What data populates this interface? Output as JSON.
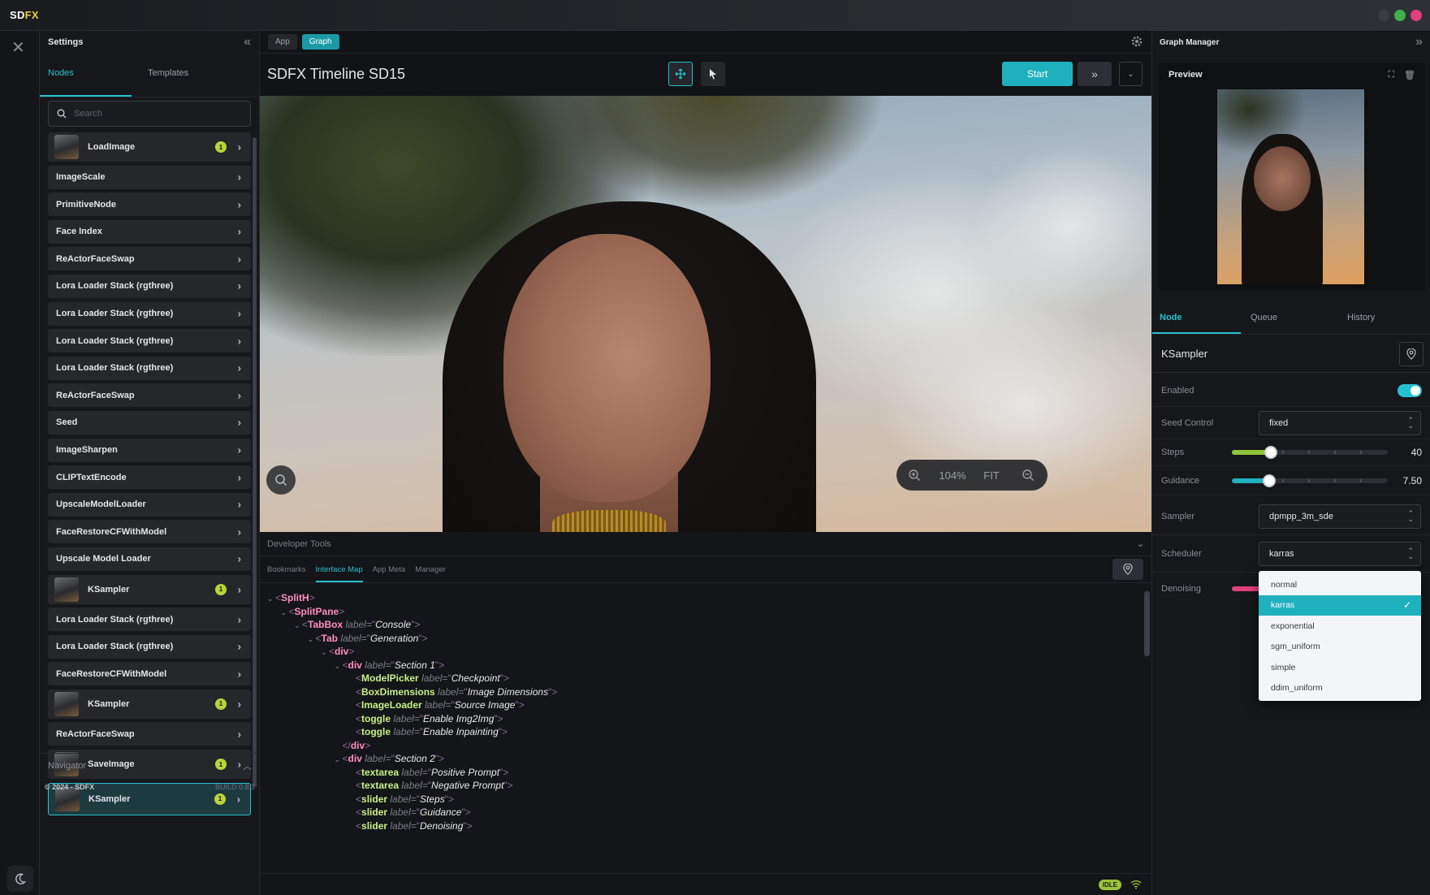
{
  "app": {
    "logo_prefix": "SD",
    "logo_suffix": "FX"
  },
  "colors": {
    "accent": "#25c1cf",
    "start": "#1fb0bd",
    "badge": "#b9d43a",
    "window_dots": [
      "#3b3d42",
      "#3fb04e",
      "#e0407a"
    ]
  },
  "left_panel": {
    "title": "Settings",
    "tabs": [
      "Nodes",
      "Templates"
    ],
    "search_placeholder": "Search",
    "nodes": [
      {
        "label": "LoadImage",
        "badge": "1",
        "thumb": true
      },
      {
        "label": "ImageScale"
      },
      {
        "label": "PrimitiveNode"
      },
      {
        "label": "Face Index"
      },
      {
        "label": "ReActorFaceSwap"
      },
      {
        "label": "Lora Loader Stack (rgthree)"
      },
      {
        "label": "Lora Loader Stack (rgthree)"
      },
      {
        "label": "Lora Loader Stack (rgthree)"
      },
      {
        "label": "Lora Loader Stack (rgthree)"
      },
      {
        "label": "ReActorFaceSwap"
      },
      {
        "label": "Seed"
      },
      {
        "label": "ImageSharpen"
      },
      {
        "label": "CLIPTextEncode"
      },
      {
        "label": "UpscaleModelLoader"
      },
      {
        "label": "FaceRestoreCFWithModel"
      },
      {
        "label": "Upscale Model Loader"
      },
      {
        "label": "KSampler",
        "badge": "1",
        "thumb": true
      },
      {
        "label": "Lora Loader Stack (rgthree)"
      },
      {
        "label": "Lora Loader Stack (rgthree)"
      },
      {
        "label": "FaceRestoreCFWithModel"
      },
      {
        "label": "KSampler",
        "badge": "1",
        "thumb": true
      },
      {
        "label": "ReActorFaceSwap"
      },
      {
        "label": "SaveImage",
        "badge": "1",
        "thumb": true
      },
      {
        "label": "KSampler",
        "badge": "1",
        "thumb": true,
        "selected": true
      }
    ],
    "navigator_label": "Navigator",
    "copyright": "© 2024 - SDFX",
    "build": "BUILD 0.8.3"
  },
  "center": {
    "mode_tabs": [
      "App",
      "Graph"
    ],
    "graph_title": "SDFX Timeline SD15",
    "start_label": "Start",
    "zoom_value": "104%",
    "fit_label": "FIT",
    "devtools": {
      "title": "Developer Tools",
      "tabs": [
        "Bookmarks",
        "Interface Map",
        "App Meta",
        "Manager"
      ],
      "tree": [
        {
          "indent": 0,
          "tw": "v",
          "tag": "SplitH",
          "kind": "open"
        },
        {
          "indent": 1,
          "tw": "v",
          "tag": "SplitPane",
          "kind": "open"
        },
        {
          "indent": 2,
          "tw": "v",
          "tag": "TabBox",
          "attr": "label=",
          "val": "Console",
          "kind": "open"
        },
        {
          "indent": 3,
          "tw": "v",
          "tag": "Tab",
          "attr": "label=",
          "val": "Generation",
          "kind": "open"
        },
        {
          "indent": 4,
          "tw": "v",
          "tag": "div",
          "kind": "open"
        },
        {
          "indent": 5,
          "tw": "v",
          "tag": "div",
          "attr": "label=",
          "val": "Section 1",
          "kind": "open"
        },
        {
          "indent": 6,
          "tw": "",
          "tag": "ModelPicker",
          "attr": "label=",
          "val": "Checkpoint",
          "kind": "self"
        },
        {
          "indent": 6,
          "tw": "",
          "tag": "BoxDimensions",
          "attr": "label=",
          "val": "Image Dimensions",
          "kind": "self"
        },
        {
          "indent": 6,
          "tw": "",
          "tag": "ImageLoader",
          "attr": "label=",
          "val": "Source Image",
          "kind": "self"
        },
        {
          "indent": 6,
          "tw": "",
          "tag": "toggle",
          "attr": "label=",
          "val": "Enable Img2Img",
          "kind": "self"
        },
        {
          "indent": 6,
          "tw": "",
          "tag": "toggle",
          "attr": "label=",
          "val": "Enable Inpainting",
          "kind": "self"
        },
        {
          "indent": 5,
          "tw": "",
          "tag": "div",
          "kind": "close"
        },
        {
          "indent": 5,
          "tw": "v",
          "tag": "div",
          "attr": "label=",
          "val": "Section 2",
          "kind": "open"
        },
        {
          "indent": 6,
          "tw": "",
          "tag": "textarea",
          "attr": "label=",
          "val": "Positive Prompt",
          "kind": "self"
        },
        {
          "indent": 6,
          "tw": "",
          "tag": "textarea",
          "attr": "label=",
          "val": "Negative Prompt",
          "kind": "self"
        },
        {
          "indent": 6,
          "tw": "",
          "tag": "slider",
          "attr": "label=",
          "val": "Steps",
          "kind": "self"
        },
        {
          "indent": 6,
          "tw": "",
          "tag": "slider",
          "attr": "label=",
          "val": "Guidance",
          "kind": "self"
        },
        {
          "indent": 6,
          "tw": "",
          "tag": "slider",
          "attr": "label=",
          "val": "Denoising",
          "kind": "self"
        }
      ]
    },
    "status": "IDLE"
  },
  "right_panel": {
    "title": "Graph Manager",
    "preview_label": "Preview",
    "tabs": [
      "Node",
      "Queue",
      "History"
    ],
    "node_name": "KSampler",
    "props": {
      "enabled_label": "Enabled",
      "enabled": true,
      "seed_control_label": "Seed Control",
      "seed_control_value": "fixed",
      "steps_label": "Steps",
      "steps_value": "40",
      "steps_fraction": 0.25,
      "guidance_label": "Guidance",
      "guidance_value": "7.50",
      "guidance_fraction": 0.24,
      "sampler_label": "Sampler",
      "sampler_value": "dpmpp_3m_sde",
      "scheduler_label": "Scheduler",
      "scheduler_value": "karras",
      "denoising_label": "Denoising"
    },
    "scheduler_options": [
      "normal",
      "karras",
      "exponential",
      "sgm_uniform",
      "simple",
      "ddim_uniform"
    ],
    "scheduler_selected": "karras"
  }
}
